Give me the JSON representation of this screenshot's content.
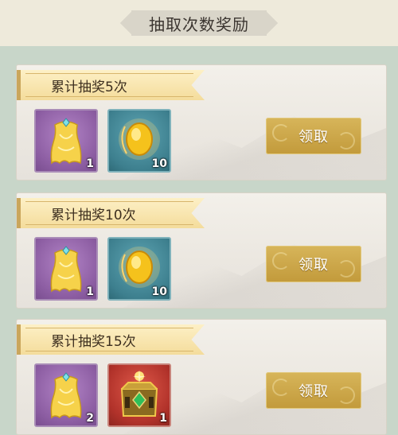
{
  "header": {
    "title": "抽取次数奖励"
  },
  "colors": {
    "claim_button": "#c9a447",
    "ribbon": "#f4dc9b",
    "panel": "#c8d6c9"
  },
  "rewards": [
    {
      "label": "累计抽奖5次",
      "button": "领取",
      "items": [
        {
          "icon": "golden-cape-icon",
          "count": "1"
        },
        {
          "icon": "gold-ingot-icon",
          "count": "10"
        }
      ]
    },
    {
      "label": "累计抽奖10次",
      "button": "领取",
      "items": [
        {
          "icon": "golden-cape-icon",
          "count": "1"
        },
        {
          "icon": "gold-ingot-icon",
          "count": "10"
        }
      ]
    },
    {
      "label": "累计抽奖15次",
      "button": "领取",
      "items": [
        {
          "icon": "golden-cape-icon",
          "count": "2"
        },
        {
          "icon": "jade-crown-icon",
          "count": "1"
        }
      ]
    }
  ]
}
